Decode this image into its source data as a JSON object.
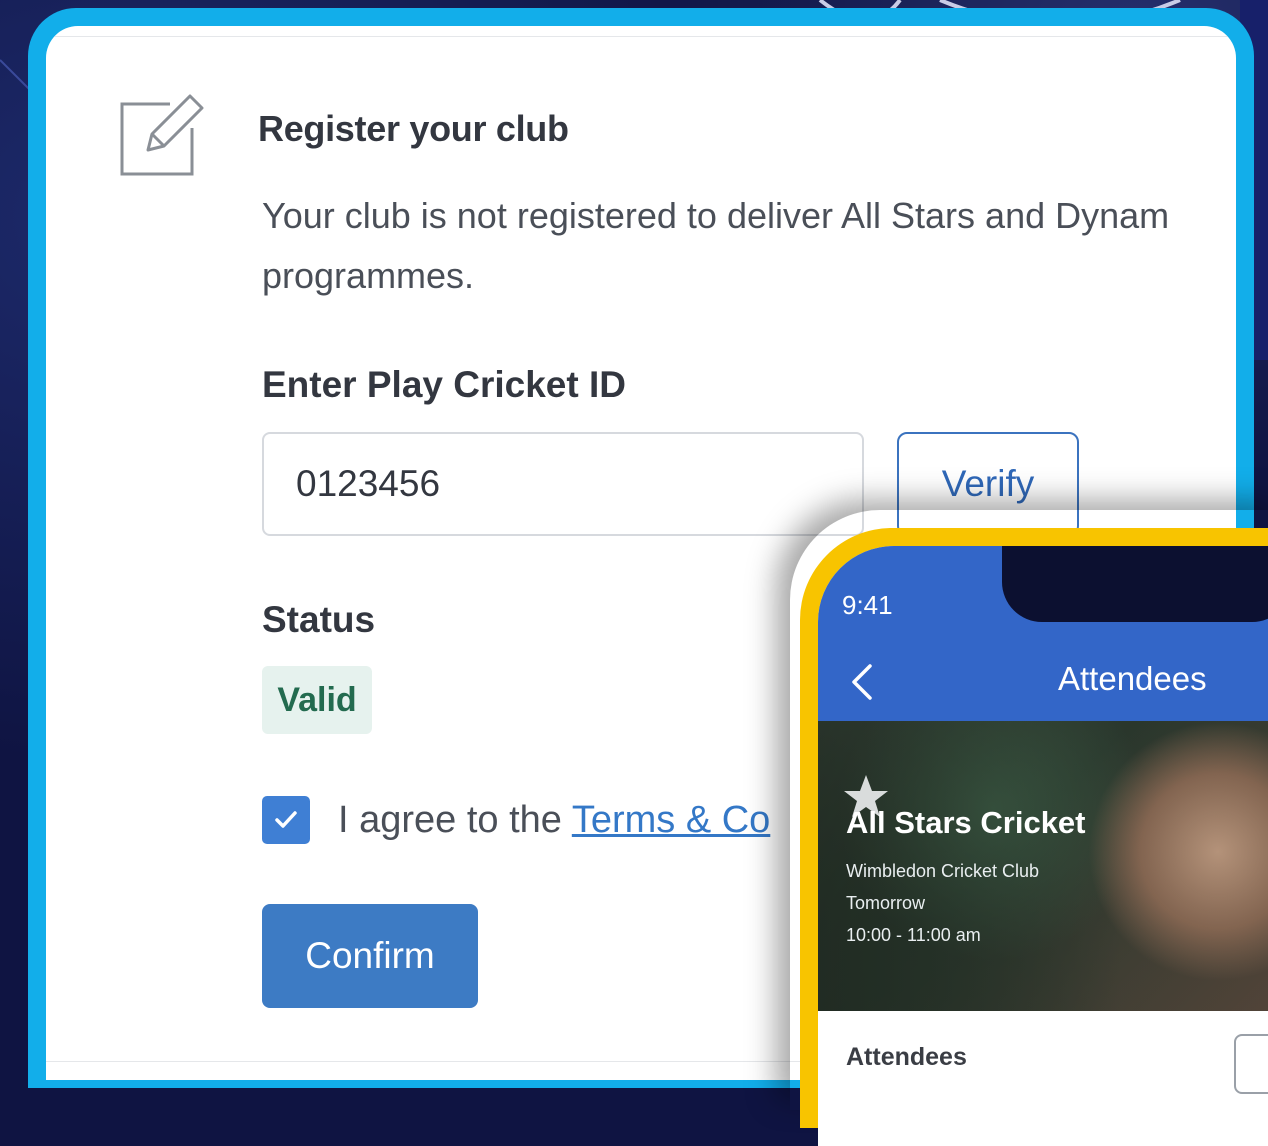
{
  "register": {
    "heading": "Register your club",
    "description_line1": "Your club is not registered to deliver All Stars and Dynam",
    "description_line2": "programmes.",
    "id_label": "Enter Play Cricket ID",
    "id_value": "0123456",
    "verify_label": "Verify",
    "status_label": "Status",
    "status_value": "Valid",
    "agree_prefix": "I agree to the ",
    "terms_link": "Terms & Co",
    "agree_checked": true,
    "confirm_label": "Confirm"
  },
  "phone": {
    "time": "9:41",
    "title": "Attendees",
    "event_title": "All Stars Cricket",
    "event_club": "Wimbledon Cricket Club",
    "event_day": "Tomorrow",
    "event_time": "10:00 - 11:00 am",
    "section_label": "Attendees"
  },
  "colors": {
    "frame_blue": "#12aeea",
    "phone_frame_yellow": "#f8c400",
    "primary_button": "#3d7bc4",
    "status_valid_bg": "#e6f2ee",
    "status_valid_text": "#236b4f",
    "phone_header": "#3366c8"
  },
  "icons": {
    "heading_icon": "edit-icon",
    "checkbox_icon": "checkmark-icon",
    "phone_back_icon": "chevron-left-icon",
    "hero_icon": "star-icon"
  }
}
